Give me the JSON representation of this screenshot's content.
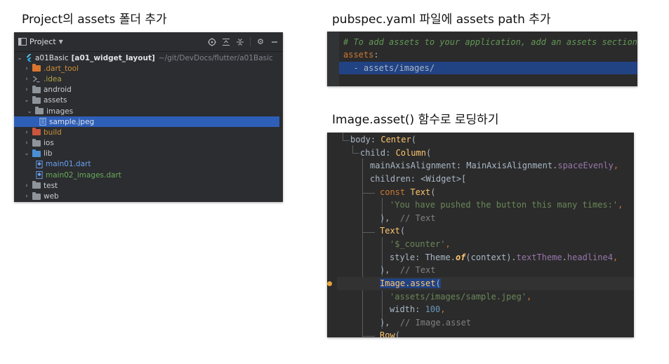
{
  "captions": {
    "project": "Project의 assets 폴더 추가",
    "pubspec": "pubspec.yaml 파일에 assets path 추가",
    "image_asset": "Image.asset() 함수로 로딩하기"
  },
  "project_panel": {
    "title": "Project",
    "root": {
      "name": "a01Basic",
      "module": "[a01_widget_layout]",
      "path": "~/git/DevDocs/flutter/a01Basic"
    },
    "items": [
      {
        "label": "dart_tool",
        "prefix": "."
      },
      {
        "label": "idea",
        "prefix": "."
      },
      {
        "label": "android"
      },
      {
        "label": "assets"
      },
      {
        "label": "images"
      },
      {
        "label": "sample.jpeg"
      },
      {
        "label": "build"
      },
      {
        "label": "ios"
      },
      {
        "label": "lib"
      },
      {
        "label": "main01.dart"
      },
      {
        "label": "main02_images.dart"
      },
      {
        "label": "test"
      },
      {
        "label": "web"
      }
    ]
  },
  "pubspec": {
    "comment": "# To add assets to your application, add an assets section, li",
    "key": "assets",
    "colon": ":",
    "item_dash": "  - ",
    "item": "assets/images/"
  },
  "dart_code": {
    "l1_key": "body",
    "l1_cls": "Center",
    "l2_key": "child",
    "l2_cls": "Column",
    "l3_key": "mainAxisAlignment",
    "l3_val_cls": "MainAxisAlignment",
    "l3_val_prop": "spaceEvenly",
    "l4_key": "children",
    "l4_val": "<Widget>[",
    "l5_kw": "const",
    "l5_cls": "Text",
    "l6_str": "'You have pushed the button this many times:'",
    "l7_comment": "// Text",
    "l8_cls": "Text",
    "l9_str": "'$_counter'",
    "l10_key": "style",
    "l10_cls": "Theme",
    "l10_static": "of",
    "l10_arg": "context",
    "l10_prop1": "textTheme",
    "l10_prop2": "headline4",
    "l11_comment": "// Text",
    "l12_cls": "Image.asset",
    "l13_str": "'assets/images/sample.jpeg'",
    "l14_key": "width",
    "l14_num": "100",
    "l15_comment": "// Image.asset",
    "l16_cls": "Row"
  }
}
